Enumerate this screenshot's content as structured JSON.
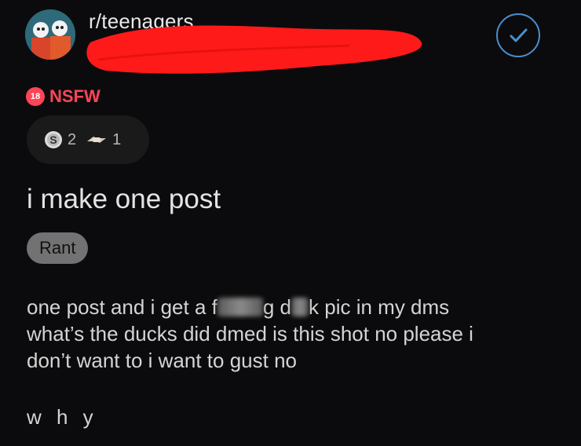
{
  "header": {
    "subreddit": "r/teenagers",
    "avatar_icon": "subreddit-avatar-icon",
    "joined_icon": "checkmark-icon",
    "accent_color": "#4b8fce"
  },
  "tags": {
    "nsfw_badge": "18",
    "nsfw_label": "NSFW",
    "nsfw_color": "#ff4458"
  },
  "awards": [
    {
      "icon": "silver-award-icon",
      "count": "2"
    },
    {
      "icon": "fist-bump-award-icon",
      "count": "1"
    }
  ],
  "post": {
    "title": "i make one post",
    "flair": "Rant",
    "body": {
      "line1_a": "one post and i get a f",
      "line1_b": "g d",
      "line1_c": "k pic in my dms",
      "line2": "what’s the ducks did dmed is this shot no please i",
      "line3": "don’t want to i want to gust no",
      "closing": "w h y"
    }
  }
}
